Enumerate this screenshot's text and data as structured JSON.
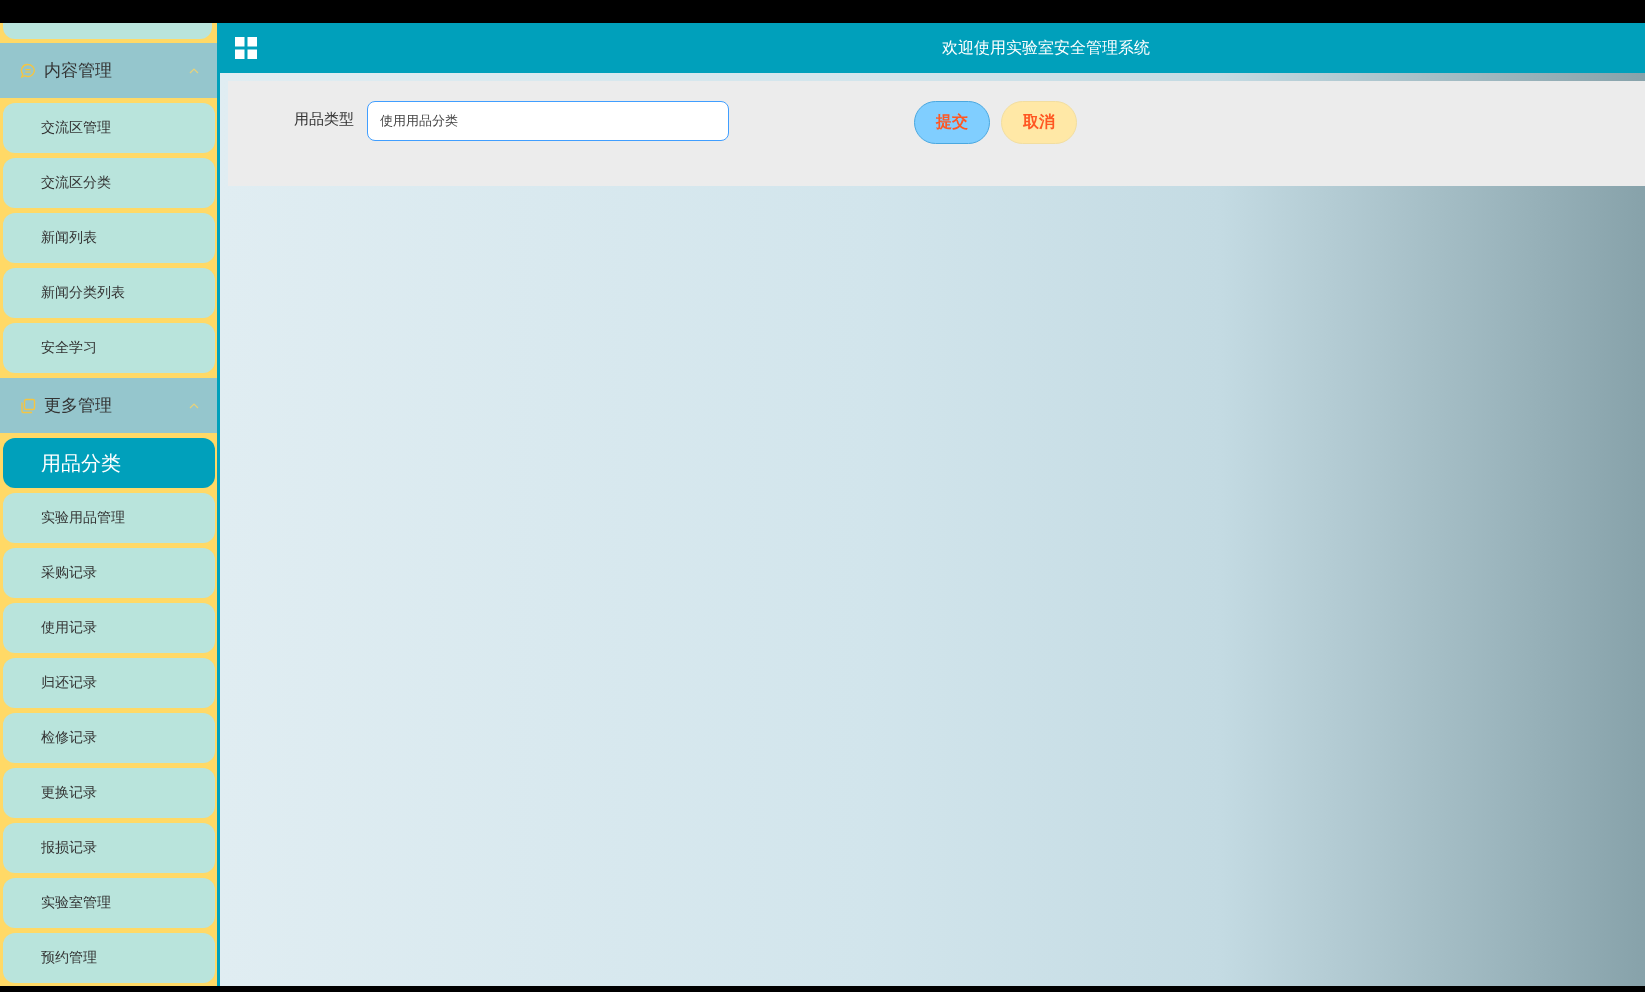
{
  "header": {
    "title": "欢迎使用实验室安全管理系统"
  },
  "sidebar": {
    "groups": [
      {
        "title": "内容管理",
        "expanded": true,
        "items": [
          {
            "label": "交流区管理",
            "selected": false
          },
          {
            "label": "交流区分类",
            "selected": false
          },
          {
            "label": "新闻列表",
            "selected": false
          },
          {
            "label": "新闻分类列表",
            "selected": false
          },
          {
            "label": "安全学习",
            "selected": false
          }
        ]
      },
      {
        "title": "更多管理",
        "expanded": true,
        "items": [
          {
            "label": "用品分类",
            "selected": true
          },
          {
            "label": "实验用品管理",
            "selected": false
          },
          {
            "label": "采购记录",
            "selected": false
          },
          {
            "label": "使用记录",
            "selected": false
          },
          {
            "label": "归还记录",
            "selected": false
          },
          {
            "label": "检修记录",
            "selected": false
          },
          {
            "label": "更换记录",
            "selected": false
          },
          {
            "label": "报损记录",
            "selected": false
          },
          {
            "label": "实验室管理",
            "selected": false
          },
          {
            "label": "预约管理",
            "selected": false
          }
        ]
      }
    ]
  },
  "form": {
    "fields": [
      {
        "label": "用品类型",
        "value": "使用用品分类"
      }
    ],
    "buttons": [
      {
        "label": "提交",
        "kind": "submit"
      },
      {
        "label": "取消",
        "kind": "cancel"
      }
    ]
  }
}
